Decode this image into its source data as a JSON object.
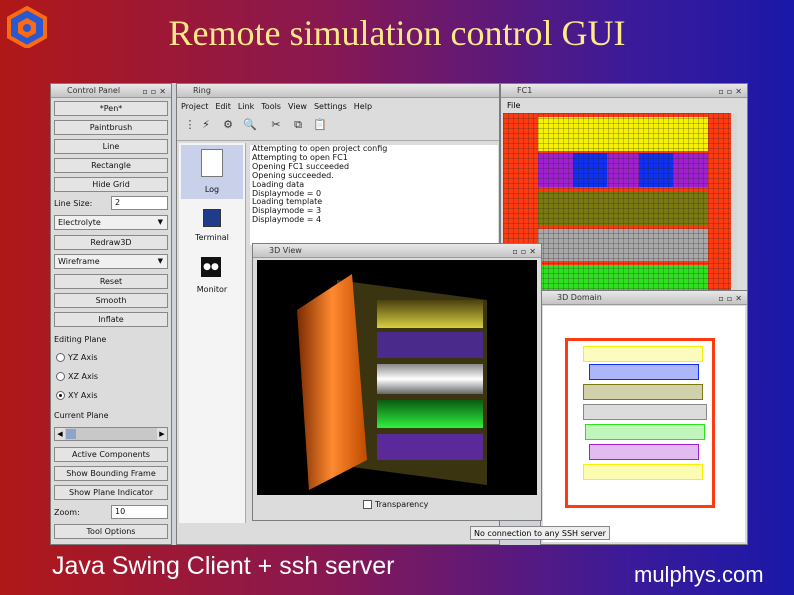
{
  "slide": {
    "title": "Remote simulation control GUI",
    "caption": "Java Swing Client + ssh server",
    "brand": "mulphys.com"
  },
  "control_panel": {
    "title": "Control Panel",
    "buttons": {
      "pen": "*Pen*",
      "paintbrush": "Paintbrush",
      "line": "Line",
      "rectangle": "Rectangle",
      "hide_grid": "Hide Grid",
      "redraw3d": "Redraw3D",
      "reset": "Reset",
      "smooth": "Smooth",
      "inflate": "Inflate",
      "active_components": "Active Components",
      "show_bounding_frame": "Show Bounding Frame",
      "show_plane_indicator": "Show Plane Indicator",
      "tool_options": "Tool Options"
    },
    "line_size_label": "Line Size:",
    "line_size_value": "2",
    "material_select": "Electrolyte",
    "render_select": "Wireframe",
    "editing_plane_label": "Editing Plane",
    "radios": [
      "YZ Axis",
      "XZ Axis",
      "XY Axis"
    ],
    "current_plane_label": "Current Plane",
    "zoom_label": "Zoom:",
    "zoom_value": "10"
  },
  "ring": {
    "title": "Ring",
    "menu": [
      "Project",
      "Edit",
      "Link",
      "Tools",
      "View",
      "Settings",
      "Help"
    ],
    "sidebar": [
      "Log",
      "Terminal",
      "Monitor"
    ],
    "log_lines": [
      "Attempting to open project config",
      "Attempting to open FC1",
      "Opening FC1 succeeded",
      "Opening succeeded.",
      "Loading data",
      "Displaymode = 0",
      "Loading template",
      "Displaymode = 3",
      "Displaymode = 4"
    ],
    "status": "No connection to any SSH server"
  },
  "fc1": {
    "title": "FC1",
    "menu_file": "File"
  },
  "view3d": {
    "title": "3D View",
    "checkbox_label": "Transparency"
  },
  "domain3d": {
    "title": "3D Domain"
  },
  "colors": {
    "yellow": "#f6f200",
    "purple": "#a020d0",
    "blue": "#1030f0",
    "olive": "#7a7a10",
    "gray": "#a8a8a8",
    "green": "#30e020",
    "red": "#ff2a10"
  }
}
